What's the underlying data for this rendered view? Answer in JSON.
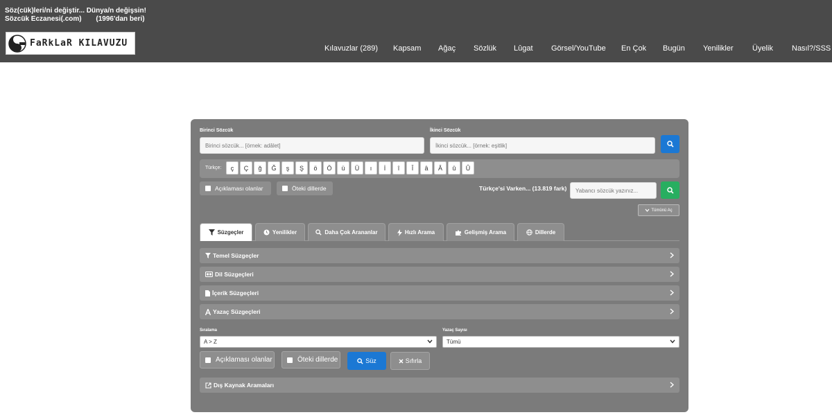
{
  "header": {
    "tagline_line1": "Söz(cük)leri/ni değiştir... Dünya/n değişsin!",
    "tagline_site": "Sözcük Eczanesi(.com)",
    "tagline_since": "(1996'dan beri)",
    "logo_text": "FaRkLaR KILAVUZU",
    "nav": [
      "Kılavuzlar (289)",
      "Kapsam",
      "Ağaç",
      "Sözlük",
      "Lûgat",
      "Görsel/YouTube",
      "En Çok",
      "Bugün",
      "Yenilikler",
      "Üyelik",
      "Nasıl?/SSS"
    ]
  },
  "search": {
    "first_label": "Birinci Sözcük",
    "first_placeholder": "Birinci sözcük... [örnek: adâlet]",
    "second_label": "İkinci Sözcük",
    "second_placeholder": "İkinci sözcük... [örnek: eşitlik]",
    "search_icon": "search-icon"
  },
  "turkish": {
    "label": "Türkçe:",
    "chars": [
      "ç",
      "Ç",
      "ğ",
      "Ğ",
      "ş",
      "Ş",
      "ö",
      "Ö",
      "ü",
      "Ü",
      "ı",
      "İ",
      "î",
      "Î",
      "â",
      "Â",
      "û",
      "Û"
    ]
  },
  "options": {
    "explained": "Açıklaması olanlar",
    "other_langs": "Öteki dillerde",
    "count_text": "Türkçe'si Varken... (13.819 fark)",
    "foreign_placeholder": "Yabancı sözcük yazınız...",
    "expand_all": "Tümünü Aç"
  },
  "tabs": [
    {
      "label": "Süzgeçler",
      "icon": "filter-icon",
      "active": true
    },
    {
      "label": "Yenilikler",
      "icon": "clock-icon",
      "active": false
    },
    {
      "label": "Daha Çok Arananlar",
      "icon": "search-icon",
      "active": false
    },
    {
      "label": "Hızlı Arama",
      "icon": "bolt-icon",
      "active": false
    },
    {
      "label": "Gelişmiş Arama",
      "icon": "puzzle-icon",
      "active": false
    },
    {
      "label": "Dillerde",
      "icon": "globe-icon",
      "active": false
    }
  ],
  "accordions": [
    {
      "label": "Temel Süzgeçler",
      "icon": "filter-icon"
    },
    {
      "label": "Dil Süzgeçleri",
      "icon": "language-icon"
    },
    {
      "label": "İçerik Süzgeçleri",
      "icon": "file-icon"
    },
    {
      "label": "Yazaç Süzgeçleri",
      "icon": "letter-a-icon"
    }
  ],
  "sort": {
    "label": "Sıralama",
    "value": "A > Z",
    "letter_count_label": "Yazaç Sayısı",
    "letter_count_value": "Tümü"
  },
  "actions": {
    "explained": "Açıklaması olanlar",
    "other_langs": "Öteki dillerde",
    "filter": "Süz",
    "reset": "Sıfırla"
  },
  "external": {
    "label": "Dış Kaynak Aramaları",
    "icon": "external-link-icon"
  },
  "colors": {
    "header_bg": "#4a4a4a",
    "panel_bg": "#7b7b7b",
    "primary": "#1b78d4",
    "success": "#27ae60"
  }
}
